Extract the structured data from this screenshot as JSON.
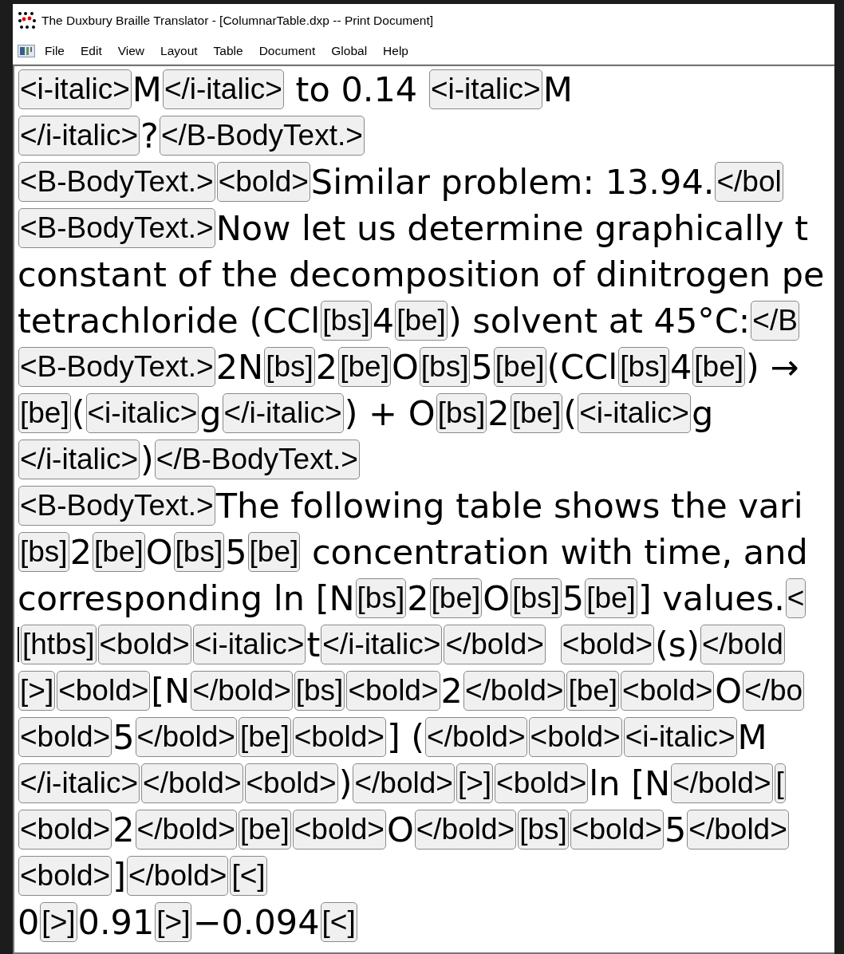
{
  "window": {
    "title": "The Duxbury Braille Translator - [ColumnarTable.dxp -- Print Document]"
  },
  "menu": [
    "File",
    "Edit",
    "View",
    "Layout",
    "Table",
    "Document",
    "Global",
    "Help"
  ],
  "document": {
    "lines": [
      {
        "cursor": false,
        "segments": [
          {
            "kind": "code",
            "text": "<i-italic>"
          },
          {
            "kind": "text",
            "text": "M"
          },
          {
            "kind": "code",
            "text": "</i-italic>"
          },
          {
            "kind": "text",
            "text": " to 0.14 "
          },
          {
            "kind": "code",
            "text": "<i-italic>"
          },
          {
            "kind": "text",
            "text": "M"
          }
        ]
      },
      {
        "cursor": false,
        "segments": [
          {
            "kind": "code",
            "text": "</i-italic>"
          },
          {
            "kind": "text",
            "text": "?"
          },
          {
            "kind": "code",
            "text": "</B-BodyText.>"
          }
        ]
      },
      {
        "cursor": false,
        "segments": [
          {
            "kind": "code",
            "text": "<B-BodyText.>"
          },
          {
            "kind": "code",
            "text": "<bold>"
          },
          {
            "kind": "text",
            "text": "Similar problem: 13.94."
          },
          {
            "kind": "code",
            "text": "</bol"
          }
        ]
      },
      {
        "cursor": false,
        "segments": [
          {
            "kind": "code",
            "text": "<B-BodyText.>"
          },
          {
            "kind": "text",
            "text": "Now let us determine graphically t"
          }
        ]
      },
      {
        "cursor": false,
        "segments": [
          {
            "kind": "text",
            "text": "constant of the decomposition of dinitrogen pe"
          }
        ]
      },
      {
        "cursor": false,
        "segments": [
          {
            "kind": "text",
            "text": "tetrachloride (CCl"
          },
          {
            "kind": "code",
            "text": "[bs]"
          },
          {
            "kind": "text",
            "text": "4"
          },
          {
            "kind": "code",
            "text": "[be]"
          },
          {
            "kind": "text",
            "text": ") solvent at 45°C:"
          },
          {
            "kind": "code",
            "text": "</B"
          }
        ]
      },
      {
        "cursor": false,
        "segments": [
          {
            "kind": "code",
            "text": "<B-BodyText.>"
          },
          {
            "kind": "text",
            "text": "2N"
          },
          {
            "kind": "code",
            "text": "[bs]"
          },
          {
            "kind": "text",
            "text": "2"
          },
          {
            "kind": "code",
            "text": "[be]"
          },
          {
            "kind": "text",
            "text": "O"
          },
          {
            "kind": "code",
            "text": "[bs]"
          },
          {
            "kind": "text",
            "text": "5"
          },
          {
            "kind": "code",
            "text": "[be]"
          },
          {
            "kind": "text",
            "text": "(CCl"
          },
          {
            "kind": "code",
            "text": "[bs]"
          },
          {
            "kind": "text",
            "text": "4"
          },
          {
            "kind": "code",
            "text": "[be]"
          },
          {
            "kind": "text",
            "text": ") →"
          }
        ]
      },
      {
        "cursor": false,
        "segments": [
          {
            "kind": "code",
            "text": "[be]"
          },
          {
            "kind": "text",
            "text": "("
          },
          {
            "kind": "code",
            "text": "<i-italic>"
          },
          {
            "kind": "text",
            "text": "g"
          },
          {
            "kind": "code",
            "text": "</i-italic>"
          },
          {
            "kind": "text",
            "text": ") + O"
          },
          {
            "kind": "code",
            "text": "[bs]"
          },
          {
            "kind": "text",
            "text": "2"
          },
          {
            "kind": "code",
            "text": "[be]"
          },
          {
            "kind": "text",
            "text": "("
          },
          {
            "kind": "code",
            "text": "<i-italic>"
          },
          {
            "kind": "text",
            "text": "g"
          }
        ]
      },
      {
        "cursor": false,
        "segments": [
          {
            "kind": "code",
            "text": "</i-italic>"
          },
          {
            "kind": "text",
            "text": ")"
          },
          {
            "kind": "code",
            "text": "</B-BodyText.>"
          }
        ]
      },
      {
        "cursor": false,
        "segments": [
          {
            "kind": "code",
            "text": "<B-BodyText.>"
          },
          {
            "kind": "text",
            "text": "The following table shows the vari"
          }
        ]
      },
      {
        "cursor": false,
        "segments": [
          {
            "kind": "code",
            "text": "[bs]"
          },
          {
            "kind": "text",
            "text": "2"
          },
          {
            "kind": "code",
            "text": "[be]"
          },
          {
            "kind": "text",
            "text": "O"
          },
          {
            "kind": "code",
            "text": "[bs]"
          },
          {
            "kind": "text",
            "text": "5"
          },
          {
            "kind": "code",
            "text": "[be]"
          },
          {
            "kind": "text",
            "text": " concentration with time, and"
          }
        ]
      },
      {
        "cursor": false,
        "segments": [
          {
            "kind": "text",
            "text": "corresponding ln [N"
          },
          {
            "kind": "code",
            "text": "[bs]"
          },
          {
            "kind": "text",
            "text": "2"
          },
          {
            "kind": "code",
            "text": "[be]"
          },
          {
            "kind": "text",
            "text": "O"
          },
          {
            "kind": "code",
            "text": "[bs]"
          },
          {
            "kind": "text",
            "text": "5"
          },
          {
            "kind": "code",
            "text": "[be]"
          },
          {
            "kind": "text",
            "text": "] values."
          },
          {
            "kind": "code",
            "text": "<"
          }
        ]
      },
      {
        "cursor": true,
        "segments": [
          {
            "kind": "code",
            "text": "[htbs]"
          },
          {
            "kind": "code",
            "text": "<bold>"
          },
          {
            "kind": "code",
            "text": "<i-italic>"
          },
          {
            "kind": "text",
            "text": "t"
          },
          {
            "kind": "code",
            "text": "</i-italic>"
          },
          {
            "kind": "code",
            "text": "</bold>"
          },
          {
            "kind": "code",
            "text": "<bold>",
            "space_before": true
          },
          {
            "kind": "text",
            "text": "(s)"
          },
          {
            "kind": "code",
            "text": "</bold"
          }
        ]
      },
      {
        "cursor": false,
        "segments": [
          {
            "kind": "code",
            "text": "[>]"
          },
          {
            "kind": "code",
            "text": "<bold>"
          },
          {
            "kind": "text",
            "text": "[N"
          },
          {
            "kind": "code",
            "text": "</bold>"
          },
          {
            "kind": "code",
            "text": "[bs]"
          },
          {
            "kind": "code",
            "text": "<bold>"
          },
          {
            "kind": "text",
            "text": "2"
          },
          {
            "kind": "code",
            "text": "</bold>"
          },
          {
            "kind": "code",
            "text": "[be]"
          },
          {
            "kind": "code",
            "text": "<bold>"
          },
          {
            "kind": "text",
            "text": "O"
          },
          {
            "kind": "code",
            "text": "</bo"
          }
        ]
      },
      {
        "cursor": false,
        "segments": [
          {
            "kind": "code",
            "text": "<bold>"
          },
          {
            "kind": "text",
            "text": "5"
          },
          {
            "kind": "code",
            "text": "</bold>"
          },
          {
            "kind": "code",
            "text": "[be]"
          },
          {
            "kind": "code",
            "text": "<bold>"
          },
          {
            "kind": "text",
            "text": "] ("
          },
          {
            "kind": "code",
            "text": "</bold>"
          },
          {
            "kind": "code",
            "text": "<bold>"
          },
          {
            "kind": "code",
            "text": "<i-italic>"
          },
          {
            "kind": "text",
            "text": "M"
          }
        ]
      },
      {
        "cursor": false,
        "segments": [
          {
            "kind": "code",
            "text": "</i-italic>"
          },
          {
            "kind": "code",
            "text": "</bold>"
          },
          {
            "kind": "code",
            "text": "<bold>"
          },
          {
            "kind": "text",
            "text": ")"
          },
          {
            "kind": "code",
            "text": "</bold>"
          },
          {
            "kind": "code",
            "text": "[>]"
          },
          {
            "kind": "code",
            "text": "<bold>"
          },
          {
            "kind": "text",
            "text": "ln [N"
          },
          {
            "kind": "code",
            "text": "</bold>"
          },
          {
            "kind": "code",
            "text": "["
          }
        ]
      },
      {
        "cursor": false,
        "segments": [
          {
            "kind": "code",
            "text": "<bold>"
          },
          {
            "kind": "text",
            "text": "2"
          },
          {
            "kind": "code",
            "text": "</bold>"
          },
          {
            "kind": "code",
            "text": "[be]"
          },
          {
            "kind": "code",
            "text": "<bold>"
          },
          {
            "kind": "text",
            "text": "O"
          },
          {
            "kind": "code",
            "text": "</bold>"
          },
          {
            "kind": "code",
            "text": "[bs]"
          },
          {
            "kind": "code",
            "text": "<bold>"
          },
          {
            "kind": "text",
            "text": "5"
          },
          {
            "kind": "code",
            "text": "</bold>"
          }
        ]
      },
      {
        "cursor": false,
        "segments": [
          {
            "kind": "code",
            "text": "<bold>"
          },
          {
            "kind": "text",
            "text": "]"
          },
          {
            "kind": "code",
            "text": "</bold>"
          },
          {
            "kind": "code",
            "text": "[<]"
          }
        ]
      },
      {
        "cursor": false,
        "segments": [
          {
            "kind": "text",
            "text": "0"
          },
          {
            "kind": "code",
            "text": "[>]"
          },
          {
            "kind": "text",
            "text": "0.91"
          },
          {
            "kind": "code",
            "text": "[>]"
          },
          {
            "kind": "text",
            "text": "−0.094"
          },
          {
            "kind": "code",
            "text": "[<]"
          }
        ]
      }
    ]
  }
}
